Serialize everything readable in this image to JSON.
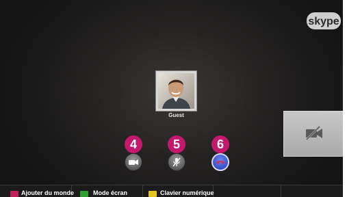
{
  "app": {
    "logo_text": "skype"
  },
  "call": {
    "contact_name": "Guest"
  },
  "controls": {
    "badges": [
      "4",
      "5",
      "6"
    ],
    "buttons": [
      {
        "name": "video",
        "icon": "video-camera-icon"
      },
      {
        "name": "mute",
        "icon": "microphone-muted-icon"
      },
      {
        "name": "end-call",
        "icon": "end-call-icon"
      }
    ]
  },
  "self_preview": {
    "icon": "video-off-icon"
  },
  "bottom_bar": {
    "items": [
      {
        "label": "Ajouter du monde",
        "color": "#c2205a"
      },
      {
        "label": "Mode écran",
        "color": "#2ba12f"
      },
      {
        "label": "Clavier numérique",
        "color": "#e3c51c"
      }
    ]
  },
  "colors": {
    "badge": "#c2196d",
    "end_call": "#3650c9",
    "background": "#1e1d1c"
  }
}
